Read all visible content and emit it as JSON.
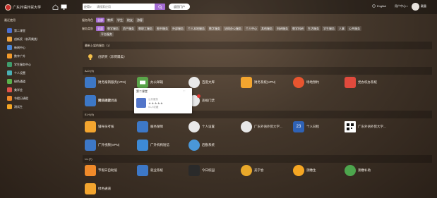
{
  "header": {
    "logo_text": "广东外语外贸大学",
    "scope": "应用",
    "search_placeholder": "请搜索应用",
    "return_portal": "返回门户",
    "lang": "English",
    "user_center": "用户中心",
    "username": "戴露"
  },
  "sidebar": {
    "title": "最近使用",
    "items": [
      {
        "label": "第二课堂",
        "icon": "classroom-icon",
        "color": "#4b6fd1"
      },
      {
        "label": "创新奖（非荷属类）",
        "icon": "innovation-icon",
        "color": "#f0a33c"
      },
      {
        "label": "新闻中心",
        "icon": "news-icon",
        "color": "#4b86d6"
      },
      {
        "label": "数字广外",
        "icon": "digital-icon",
        "color": "#f39a2a"
      },
      {
        "label": "学生服务中心",
        "icon": "student-service-icon",
        "color": "#3f9c6c"
      },
      {
        "label": "个人设置",
        "icon": "settings-icon",
        "color": "#4bb0b5"
      },
      {
        "label": "绿色通道",
        "icon": "green-channel-icon",
        "color": "#5ab14b"
      },
      {
        "label": "美学会",
        "icon": "aesthetics-icon",
        "color": "#e0524a"
      },
      {
        "label": "节假日请假",
        "icon": "holiday-leave-icon",
        "color": "#f08a2a"
      },
      {
        "label": "测试生",
        "icon": "test-student-icon",
        "color": "#f5a623"
      }
    ]
  },
  "filters": {
    "service_label": "服务角色",
    "roles": [
      "全部",
      "教师",
      "学生",
      "校友",
      "游客"
    ],
    "category_label": "服务类别",
    "categories": [
      "全部",
      "教学服务",
      "资产服务",
      "教职工服务",
      "图书服务",
      "外部服务",
      "个人本地服务",
      "数字服务",
      "协同办公服务",
      "个人中心",
      "其他服务",
      "科研服务",
      "教学科研",
      "生活服务",
      "学生服务",
      "人事",
      "公共服务",
      "平台服务"
    ]
  },
  "sections": {
    "recent_header": "最新上架的服务（1）",
    "recent_app": "创新奖（非荷属类）",
    "ad_header": "A-D (9)",
    "eh_header": "E-H (9)",
    "il_header": "I-L (7)"
  },
  "apps": {
    "row1": [
      "财务报销服务(VPN)",
      "办公邮箱",
      "百度文库",
      "财务系统(VPN)",
      "场地预约",
      "党办校办系统"
    ],
    "row2": [
      "第二课堂",
      "网络问题调查",
      "违规门禁"
    ],
    "row3": [
      "辅导员考核",
      "服务保障",
      "个人设置",
      "广东外语外贸大学...",
      "个人日程",
      "广东外语外贸大学..."
    ],
    "row4": [
      "广外视频(VPN)",
      "广外机构短信",
      "后勤系统"
    ],
    "row5": [
      "节假日自助值",
      "就业系统",
      "今日校园",
      "美学会",
      "测缴生",
      "测缴补助"
    ],
    "row6": [
      "绿色通道"
    ],
    "calendar_day": "23"
  },
  "popup": {
    "title": "第二课堂",
    "heart": "♡",
    "type": "公共服务",
    "stars": "★★★★★",
    "count": "51人收藏"
  },
  "colors": {
    "accent": "#a46bd2"
  }
}
